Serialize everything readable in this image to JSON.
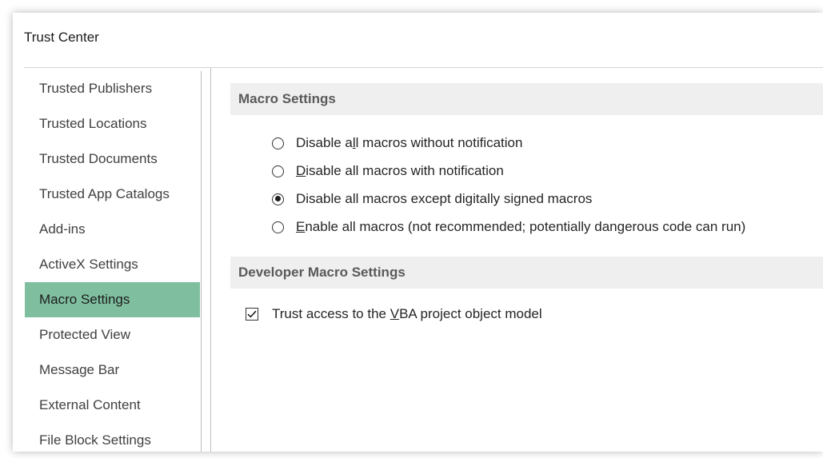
{
  "window": {
    "title": "Trust Center"
  },
  "sidebar": {
    "selected_color": "#7fbf9f",
    "items": [
      {
        "label": "Trusted Publishers"
      },
      {
        "label": "Trusted Locations"
      },
      {
        "label": "Trusted Documents"
      },
      {
        "label": "Trusted App Catalogs"
      },
      {
        "label": "Add-ins"
      },
      {
        "label": "ActiveX Settings"
      },
      {
        "label": "Macro Settings",
        "selected": true
      },
      {
        "label": "Protected View"
      },
      {
        "label": "Message Bar"
      },
      {
        "label": "External Content"
      },
      {
        "label": "File Block Settings"
      }
    ]
  },
  "macro_settings": {
    "header": "Macro Settings",
    "options": [
      {
        "pre": "Disable a",
        "key": "l",
        "post": "l macros without notification",
        "checked": false
      },
      {
        "pre": "",
        "key": "D",
        "post": "isable all macros with notification",
        "checked": false
      },
      {
        "pre": "Disable all macros except di",
        "key": "g",
        "post": "itally signed macros",
        "checked": true
      },
      {
        "pre": "",
        "key": "E",
        "post": "nable all macros (not recommended; potentially dangerous code can run)",
        "checked": false
      }
    ]
  },
  "developer_macro_settings": {
    "header": "Developer Macro Settings",
    "trust_vba": {
      "pre": "Trust access to the ",
      "key": "V",
      "post": "BA project object model",
      "checked": true
    }
  }
}
